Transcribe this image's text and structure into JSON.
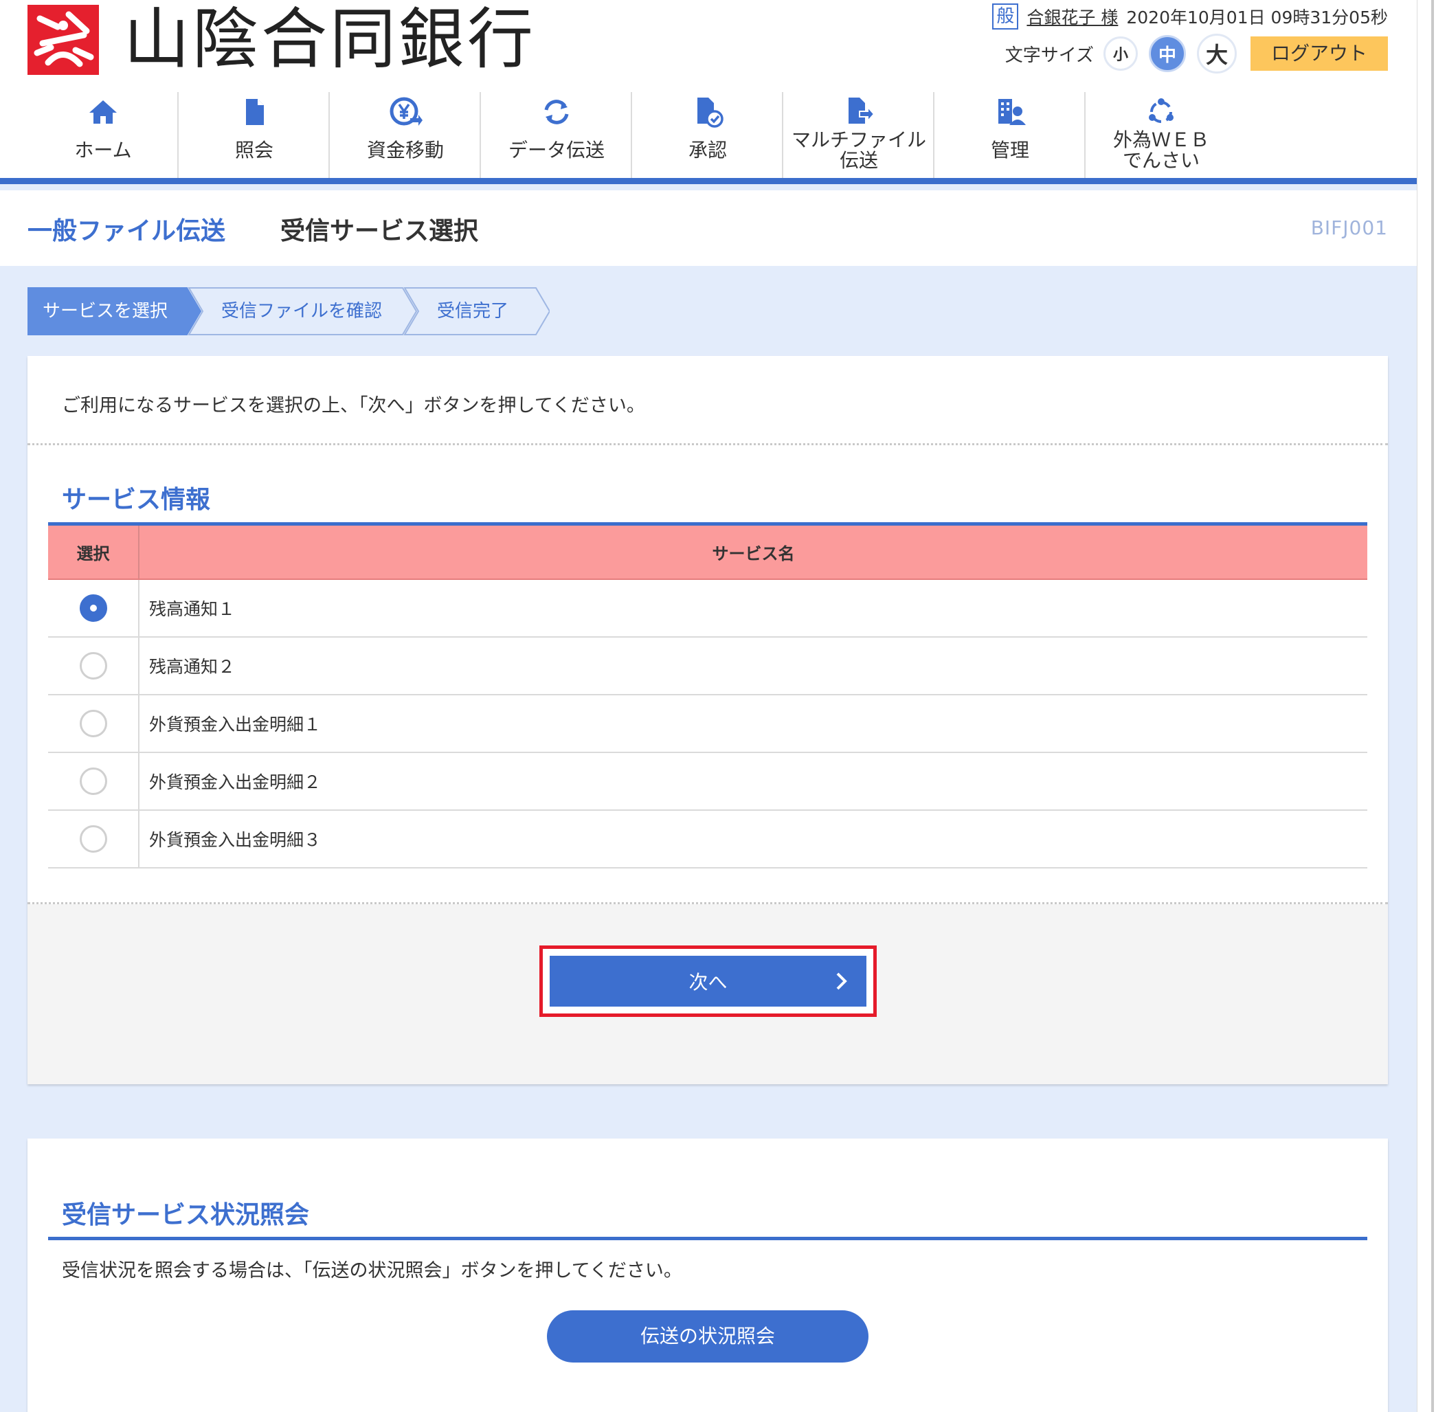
{
  "header": {
    "bank_name": "山陰合同銀行",
    "user_badge": "般",
    "user_name": "合銀花子 様",
    "datetime": "2020年10月01日 09時31分05秒",
    "font_size_label": "文字サイズ",
    "font_sizes": {
      "small": "小",
      "medium": "中",
      "large": "大"
    },
    "logout_label": "ログアウト"
  },
  "nav": [
    {
      "label": "ホーム",
      "icon": "home-icon"
    },
    {
      "label": "照会",
      "icon": "document-icon"
    },
    {
      "label": "資金移動",
      "icon": "yen-transfer-icon"
    },
    {
      "label": "データ伝送",
      "icon": "refresh-icon"
    },
    {
      "label": "承認",
      "icon": "approve-document-icon"
    },
    {
      "label": "マルチファイル\n伝送",
      "icon": "file-export-icon"
    },
    {
      "label": "管理",
      "icon": "building-user-icon"
    },
    {
      "label": "外為ＷＥＢ\nでんさい",
      "icon": "cycle-icon"
    }
  ],
  "title": {
    "category": "一般ファイル伝送",
    "main": "受信サービス選択",
    "screen_id": "BIFJ001"
  },
  "steps": [
    "サービスを選択",
    "受信ファイルを確認",
    "受信完了"
  ],
  "selection": {
    "instruction": "ご利用になるサービスを選択の上、「次へ」ボタンを押してください。",
    "section_title": "サービス情報",
    "columns": {
      "select": "選択",
      "service_name": "サービス名"
    },
    "services": [
      {
        "name": "残高通知１",
        "checked": true
      },
      {
        "name": "残高通知２",
        "checked": false
      },
      {
        "name": "外貨預金入出金明細１",
        "checked": false
      },
      {
        "name": "外貨預金入出金明細２",
        "checked": false
      },
      {
        "name": "外貨預金入出金明細３",
        "checked": false
      }
    ],
    "next_label": "次へ"
  },
  "status": {
    "title": "受信サービス状況照会",
    "text": "受信状況を照会する場合は、「伝送の状況照会」ボタンを押してください。",
    "button_label": "伝送の状況照会"
  },
  "colors": {
    "accent_blue": "#3d6fcf",
    "header_pink": "#fb9b9b",
    "logout_yellow": "#fdc65c",
    "highlight_red": "#e51b2a",
    "logo_red": "#e5202e"
  }
}
